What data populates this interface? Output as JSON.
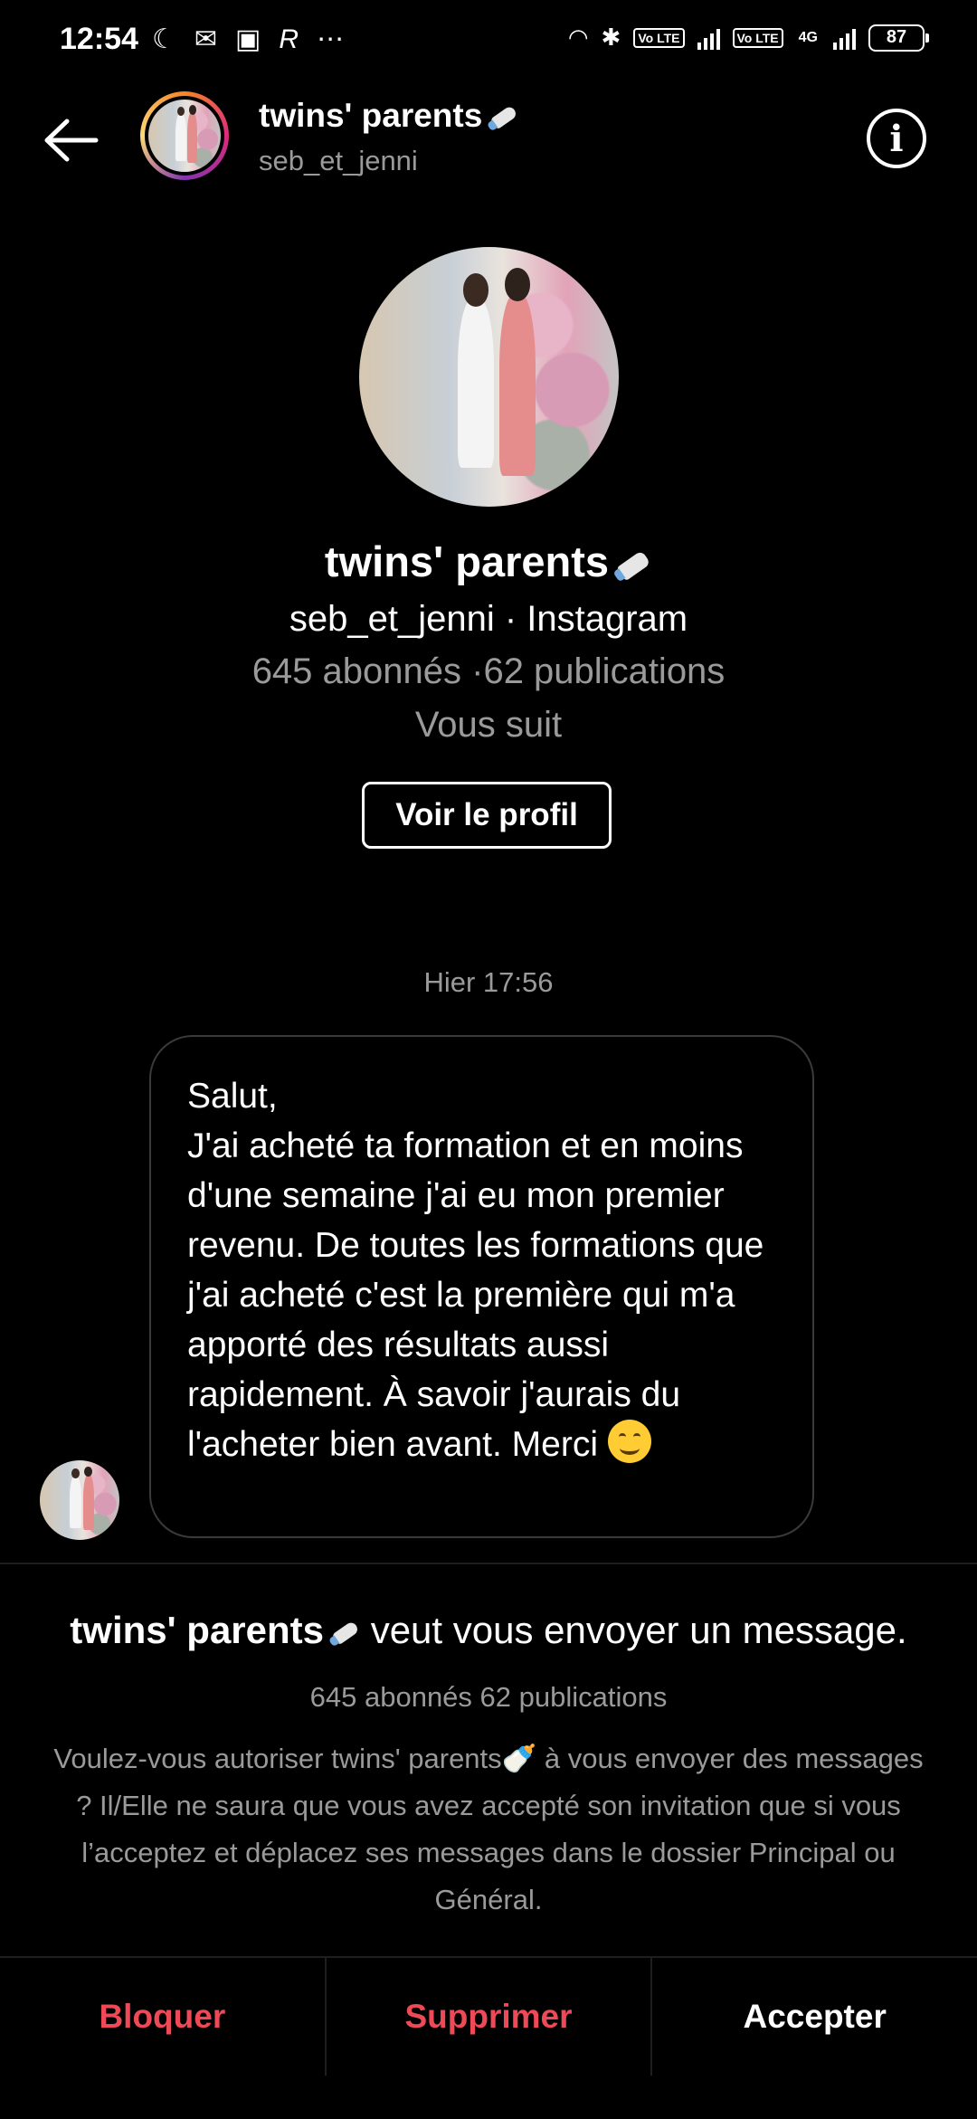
{
  "status_bar": {
    "time": "12:54",
    "left_icons": [
      "moon-icon",
      "outlook-icon",
      "teams-icon",
      "r-app-icon",
      "more-dots-icon"
    ],
    "right_tags": [
      "Vo LTE",
      "Vo LTE",
      "4G"
    ],
    "battery": "87"
  },
  "header": {
    "name": "twins' parents",
    "username": "seb_et_jenni",
    "info_glyph": "i"
  },
  "profile": {
    "name": "twins' parents",
    "subtitle": "seb_et_jenni · Instagram",
    "stats": "645 abonnés ·62 publications",
    "follow_status": "Vous suit",
    "view_profile_label": "Voir le profil"
  },
  "conversation": {
    "timestamp": "Hier 17:56",
    "message_lines": [
      "Salut,",
      "J'ai acheté ta formation et en moins d'une semaine j'ai eu mon premier revenu. De toutes les formations que j'ai acheté c'est la première qui m'a apporté des résultats aussi rapidement. À savoir j'aurais du l'acheter bien avant. Merci"
    ],
    "emoji": "smiling-face-emoji"
  },
  "request": {
    "name": "twins' parents",
    "title_suffix": "veut vous envoyer un message.",
    "stats": "645 abonnés 62 publications",
    "body": "Voulez-vous autoriser twins' parents🍼 à vous envoyer des messages ? Il/Elle ne saura que vous avez accepté son invitation que si vous l’acceptez et déplacez ses messages dans le dossier Principal ou Général."
  },
  "actions": {
    "block": "Bloquer",
    "delete": "Supprimer",
    "accept": "Accepter"
  },
  "colors": {
    "background": "#000000",
    "danger": "#ed4956",
    "muted": "#9a9a9a"
  }
}
